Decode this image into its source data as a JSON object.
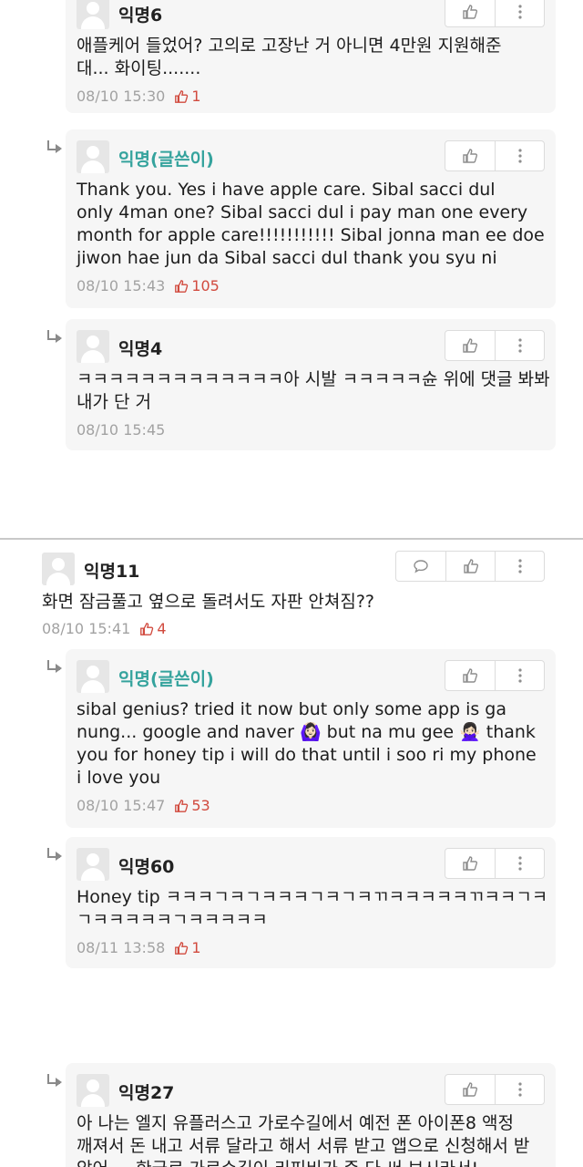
{
  "comments": [
    {
      "nick": "익명6",
      "lines": [
        "애플케어 들었어? 고의로 고장난 거 아니면 4만원 지원해준",
        "대... 화이팅......."
      ],
      "time": "08/10 15:30",
      "likes": "1"
    },
    {
      "nick": "익명(글쓴이)",
      "lines": [
        "Thank you. Yes i have apple care. Sibal sacci dul",
        "only 4man one? Sibal sacci dul i pay man one every",
        "month for apple care!!!!!!!!!!! Sibal jonna man ee doe",
        "jiwon hae jun da Sibal sacci dul thank you syu ni"
      ],
      "time": "08/10 15:43",
      "likes": "105"
    },
    {
      "nick": "익명4",
      "lines": [
        "ㅋㅋㅋㅋㅋㅋㅋㅋㅋㅋㅋㅋㅋ아 시발 ㅋㅋㅋㅋㅋ슌 위에 댓글 봐봐",
        "내가 단 거"
      ],
      "time": "08/10 15:45",
      "likes": ""
    },
    {
      "nick": "익명11",
      "lines": [
        "화면 잠금풀고 옆으로 돌려서도 자판 안쳐짐??"
      ],
      "time": "08/10 15:41",
      "likes": "4"
    },
    {
      "nick": "익명(글쓴이)",
      "lines": [
        "sibal genius? tried it now but only some app is ga",
        "nung... google and naver 🙆🏻‍♀️ but na mu gee 🙅🏻‍♀️ thank",
        "you for honey tip i will do that until i soo ri my phone",
        "i love you"
      ],
      "time": "08/10 15:47",
      "likes": "53"
    },
    {
      "nick": "익명60",
      "lines": [
        "Honey tip ㅋㅋㅋㄱㅋㄱㅋㅋㅋㄱㅋㄱㅋㄲㅋㅋㅋㅋㅋㄲㅋㅋㄱㅋ",
        "ㄱㅋㅋㅋㅋㅋㄱㅋㅋㅋㅋㅋ"
      ],
      "time": "08/11 13:58",
      "likes": "1"
    },
    {
      "nick": "익명27",
      "lines": [
        "아 나는 엘지 유플러스고 가로수길에서 예전 폰 아이폰8 액정",
        "깨져서 돈 내고 서류 달라고 해서 서류 받고 앱으로 신청해서 받",
        "았어 ... 한국로 가로수길이 리피비가 준 다 써 보시라서!"
      ],
      "time": "",
      "likes": ""
    }
  ],
  "icons": {
    "like": "thumbs-up-icon",
    "more": "more-vertical-icon",
    "reply": "speech-bubble-icon",
    "arrow": "reply-arrow-icon"
  },
  "colors": {
    "author": "#35a39d",
    "likes": "#d14a3e",
    "meta": "#a2a2a2"
  }
}
